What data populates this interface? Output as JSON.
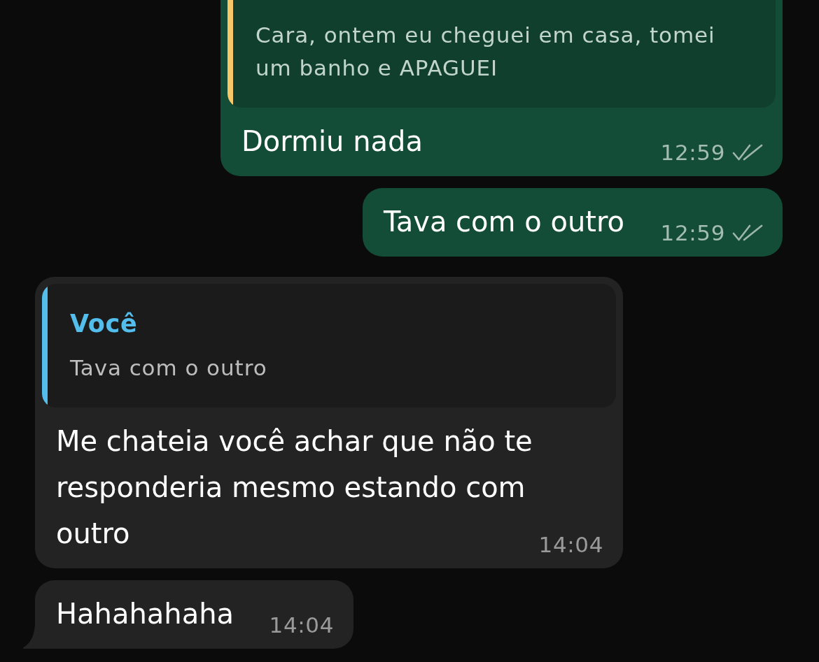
{
  "messages": [
    {
      "kind": "outgoing",
      "quote": {
        "text": "Cara, ontem eu cheguei em casa, tomei um banho e APAGUEI",
        "color": "#f6c86a"
      },
      "text": "Dormiu nada",
      "time": "12:59",
      "delivered": true,
      "read": false,
      "tail": false
    },
    {
      "kind": "outgoing",
      "text": "Tava com o outro",
      "time": "12:59",
      "delivered": true,
      "read": false,
      "tail": false
    },
    {
      "kind": "incoming",
      "quote": {
        "sender": "Você",
        "text": "Tava com o outro",
        "color": "#53bdeb"
      },
      "text": "Me chateia você achar que não te responderia mesmo estando com outro",
      "time": "14:04",
      "tail": false
    },
    {
      "kind": "incoming",
      "text": "Hahahahaha",
      "time": "14:04",
      "tail": true
    }
  ]
}
